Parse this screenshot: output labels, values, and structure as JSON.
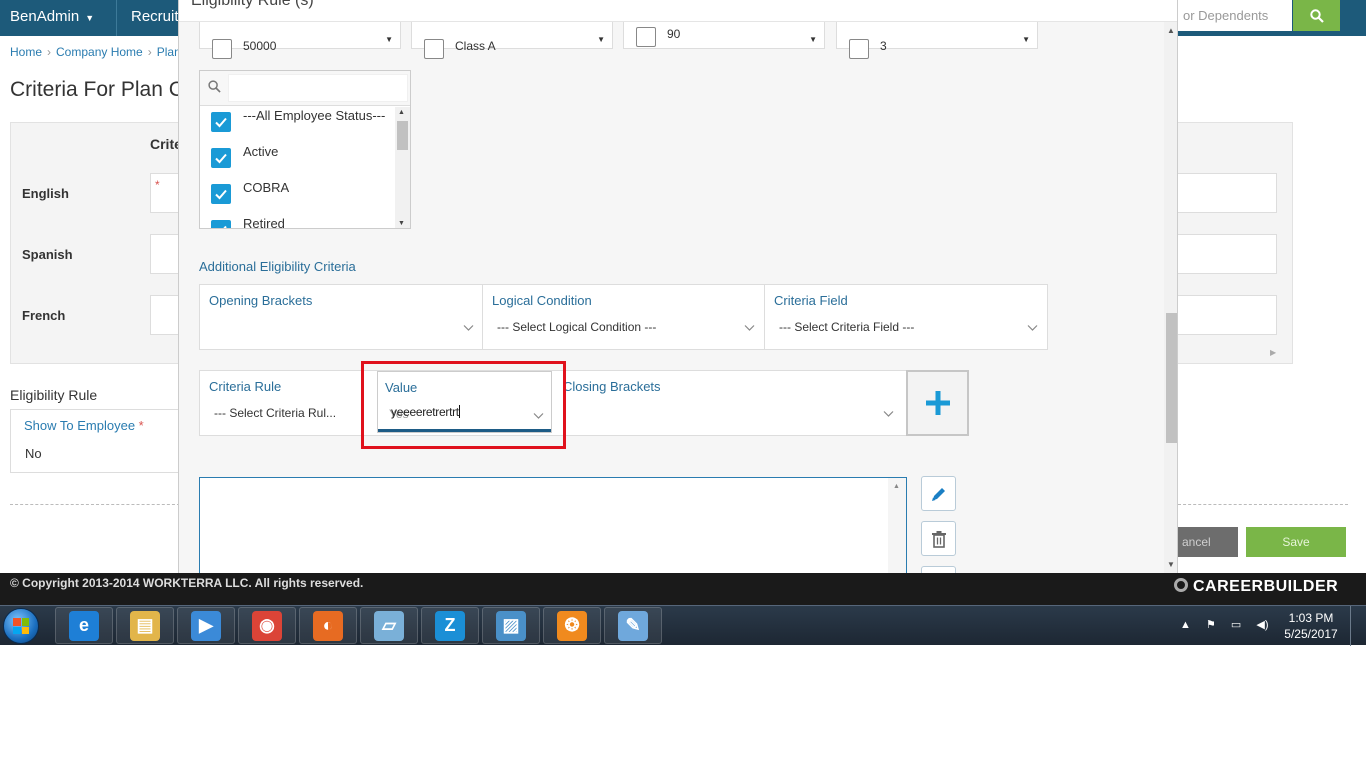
{
  "topnav": {
    "brand": "BenAdmin",
    "nav_item": "Recruit",
    "search_placeholder": "or Dependents"
  },
  "breadcrumb": {
    "items": [
      "Home",
      "Company Home",
      "Plan"
    ]
  },
  "page": {
    "title": "Criteria For Plan C",
    "table_header": "Crite",
    "languages": [
      "English",
      "Spanish",
      "French"
    ],
    "required_mark": "*",
    "eligibility_section": "Eligibility Rule",
    "show_to_employee_label": "Show To Employee",
    "show_to_employee_value": "No",
    "cancel_label": "ancel",
    "save_label": "Save"
  },
  "footer": {
    "copyright": "© Copyright 2013-2014 WORKTERRA LLC. All rights reserved.",
    "brand": "CAREERBUILDER"
  },
  "modal": {
    "title": "Eligibility Rule (s)",
    "top_selects": [
      {
        "value": "50000"
      },
      {
        "value": "Class A"
      },
      {
        "value": "90"
      },
      {
        "value": "3"
      }
    ],
    "status_list": {
      "items": [
        {
          "label": "---All Employee Status---",
          "checked": true
        },
        {
          "label": "Active",
          "checked": true
        },
        {
          "label": "COBRA",
          "checked": true
        },
        {
          "label": "Retired",
          "checked": true
        }
      ]
    },
    "additional_label": "Additional Eligibility Criteria",
    "row1": {
      "opening_brackets": {
        "label": "Opening Brackets",
        "value": ""
      },
      "logical_condition": {
        "label": "Logical Condition",
        "value": "--- Select Logical Condition ---"
      },
      "criteria_field": {
        "label": "Criteria Field",
        "value": "--- Select Criteria Field ---"
      }
    },
    "row2": {
      "criteria_rule": {
        "label": "Criteria Rule",
        "value": "--- Select Criteria Rul..."
      },
      "value": {
        "label": "Value",
        "placeholder": "Yes",
        "typed": "yeeeeretrertrt"
      },
      "closing_brackets": {
        "label": "Closing Brackets",
        "value": ""
      }
    },
    "add_button_symbol": "+"
  },
  "taskbar": {
    "apps": [
      {
        "name": "internet-explorer-icon",
        "color": "#1e7fd6"
      },
      {
        "name": "file-explorer-icon",
        "color": "#e2b54a"
      },
      {
        "name": "media-player-icon",
        "color": "#3b8ad8"
      },
      {
        "name": "chrome-icon",
        "color": "#db4437"
      },
      {
        "name": "firefox-icon",
        "color": "#e76b22"
      },
      {
        "name": "notepad-app-icon",
        "color": "#7ab0d8"
      },
      {
        "name": "z-app-icon",
        "color": "#1b8fd6"
      },
      {
        "name": "photo-viewer-icon",
        "color": "#4a90c8"
      },
      {
        "name": "flame-app-icon",
        "color": "#f08a1e"
      },
      {
        "name": "paint-icon",
        "color": "#6fa8dc"
      }
    ],
    "time": "1:03 PM",
    "date": "5/25/2017"
  }
}
